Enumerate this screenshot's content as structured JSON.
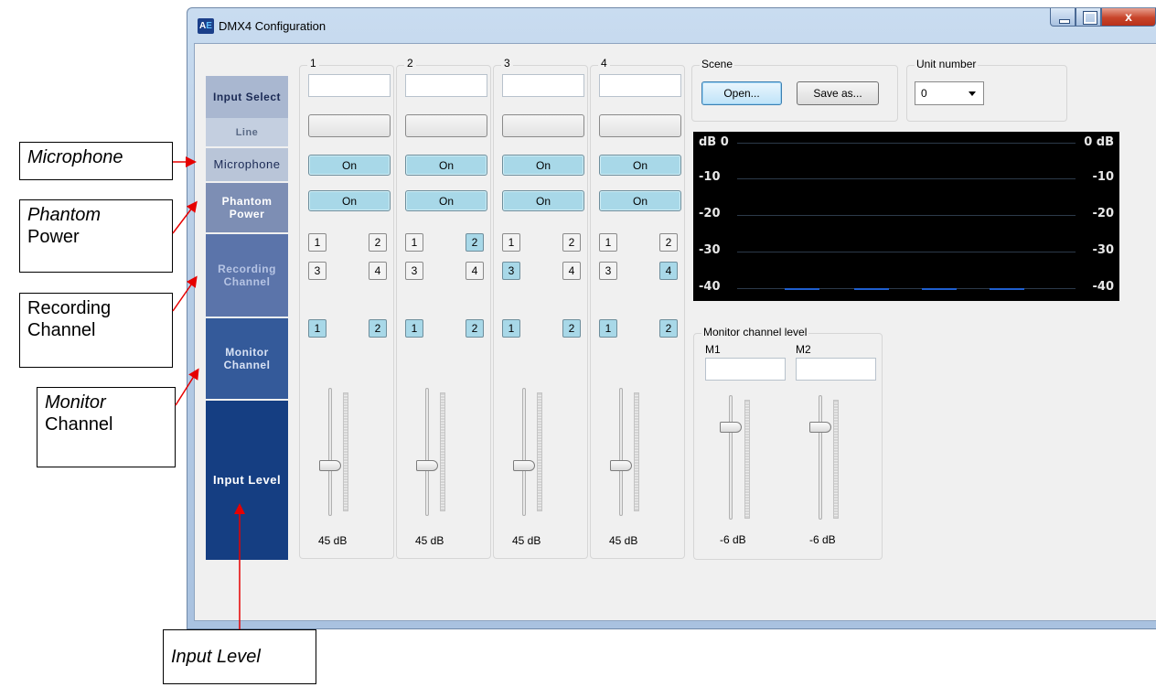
{
  "window": {
    "title": "DMX4 Configuration",
    "app_icon_text": "AE",
    "close_glyph": "x"
  },
  "labels": {
    "input_select": "Input Select",
    "line": "Line",
    "microphone": "Microphone",
    "phantom_power": "Phantom Power",
    "recording_channel": "Recording Channel",
    "monitor_channel": "Monitor Channel",
    "input_level": "Input Level"
  },
  "channels": [
    {
      "number": "1",
      "input_value": "",
      "mic": "On",
      "phantom": "On",
      "rec": [
        "1",
        "2",
        "3",
        "4"
      ],
      "rec_on": [
        false,
        false,
        false,
        false
      ],
      "mon": [
        "1",
        "2"
      ],
      "mon_on": [
        true,
        true
      ],
      "level": "45 dB",
      "level_fraction": 0.38
    },
    {
      "number": "2",
      "input_value": "",
      "mic": "On",
      "phantom": "On",
      "rec": [
        "1",
        "2",
        "3",
        "4"
      ],
      "rec_on": [
        false,
        true,
        false,
        false
      ],
      "mon": [
        "1",
        "2"
      ],
      "mon_on": [
        true,
        true
      ],
      "level": "45 dB",
      "level_fraction": 0.38
    },
    {
      "number": "3",
      "input_value": "",
      "mic": "On",
      "phantom": "On",
      "rec": [
        "1",
        "2",
        "3",
        "4"
      ],
      "rec_on": [
        false,
        false,
        true,
        false
      ],
      "mon": [
        "1",
        "2"
      ],
      "mon_on": [
        true,
        true
      ],
      "level": "45 dB",
      "level_fraction": 0.38
    },
    {
      "number": "4",
      "input_value": "",
      "mic": "On",
      "phantom": "On",
      "rec": [
        "1",
        "2",
        "3",
        "4"
      ],
      "rec_on": [
        false,
        false,
        false,
        true
      ],
      "mon": [
        "1",
        "2"
      ],
      "mon_on": [
        true,
        true
      ],
      "level": "45 dB",
      "level_fraction": 0.38
    }
  ],
  "scene": {
    "title": "Scene",
    "open_label": "Open...",
    "save_as_label": "Save as..."
  },
  "unit": {
    "title": "Unit number",
    "value": "0"
  },
  "db_meter": {
    "top_left": "dB  0",
    "top_right": "0  dB",
    "ticks": [
      "-10",
      "-20",
      "-30",
      "-40"
    ],
    "bar_color": "#1f5fcf"
  },
  "monitor_level": {
    "title": "Monitor channel level",
    "m1_label": "M1",
    "m2_label": "M2",
    "m1_value": "",
    "m2_value": "",
    "m1_level": "-6 dB",
    "m2_level": "-6 dB",
    "level_fraction": 0.78
  },
  "annotations": {
    "microphone": "Microphone",
    "phantom_1": "Phantom",
    "phantom_2": "Power",
    "recording_1": "Recording",
    "recording_2": "Channel",
    "monitor_1": "Monitor",
    "monitor_2": "Channel",
    "input_level": "Input Level"
  },
  "colors": {
    "active_button": "#a8d8e8",
    "annotation_arrow": "#e60000",
    "label_dark": "#153e82"
  }
}
